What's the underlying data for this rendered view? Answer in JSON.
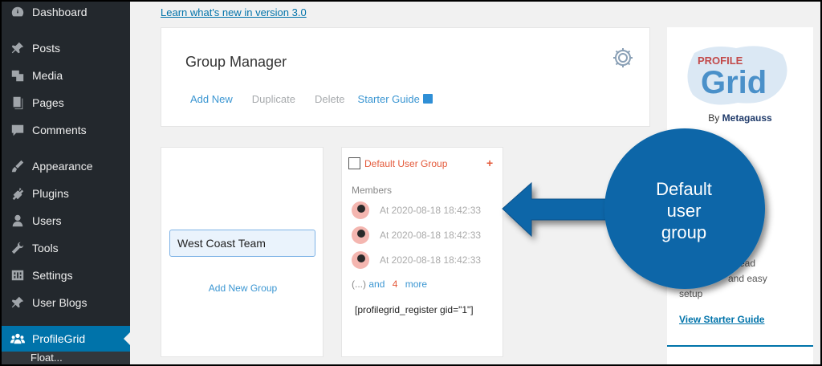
{
  "sidebar": {
    "items": [
      {
        "label": "Dashboard",
        "icon": "dashboard-icon"
      },
      {
        "label": "Posts",
        "icon": "pin-icon"
      },
      {
        "label": "Media",
        "icon": "media-icon"
      },
      {
        "label": "Pages",
        "icon": "pages-icon"
      },
      {
        "label": "Comments",
        "icon": "comments-icon"
      },
      {
        "label": "Appearance",
        "icon": "brush-icon"
      },
      {
        "label": "Plugins",
        "icon": "plugin-icon"
      },
      {
        "label": "Users",
        "icon": "users-icon"
      },
      {
        "label": "Tools",
        "icon": "wrench-icon"
      },
      {
        "label": "Settings",
        "icon": "settings-icon"
      },
      {
        "label": "User Blogs",
        "icon": "pin-icon"
      },
      {
        "label": "ProfileGrid",
        "icon": "group-icon",
        "active": true
      }
    ],
    "sub_label": "Float..."
  },
  "top_link": "Learn what's new in version 3.0",
  "header": {
    "title": "Group Manager",
    "actions": {
      "add_new": "Add New",
      "duplicate": "Duplicate",
      "delete": "Delete",
      "starter_guide": "Starter Guide"
    }
  },
  "left_panel": {
    "group_name_value": "West Coast Team",
    "add_group": "Add New Group"
  },
  "group_card": {
    "name": "Default User Group",
    "plus": "+",
    "members_label": "Members",
    "members": [
      {
        "text": "At 2020-08-18 18:42:33"
      },
      {
        "text": "At 2020-08-18 18:42:33"
      },
      {
        "text": "At 2020-08-18 18:42:33"
      }
    ],
    "more_prefix": "(...)",
    "more_and": "and",
    "more_count": "4",
    "more_suffix": "more",
    "shortcode": "[profilegrid_register gid=\"1\"]"
  },
  "promo": {
    "logo_top": "PROFILE",
    "logo_main": "Grid",
    "by": "By",
    "brand": "Metagauss",
    "text1": "d read",
    "text2": "and easy",
    "text3": "setup",
    "link": "View Starter Guide"
  },
  "callout": {
    "line1": "Default",
    "line2": "user",
    "line3": "group",
    "color": "#0a66a8"
  }
}
